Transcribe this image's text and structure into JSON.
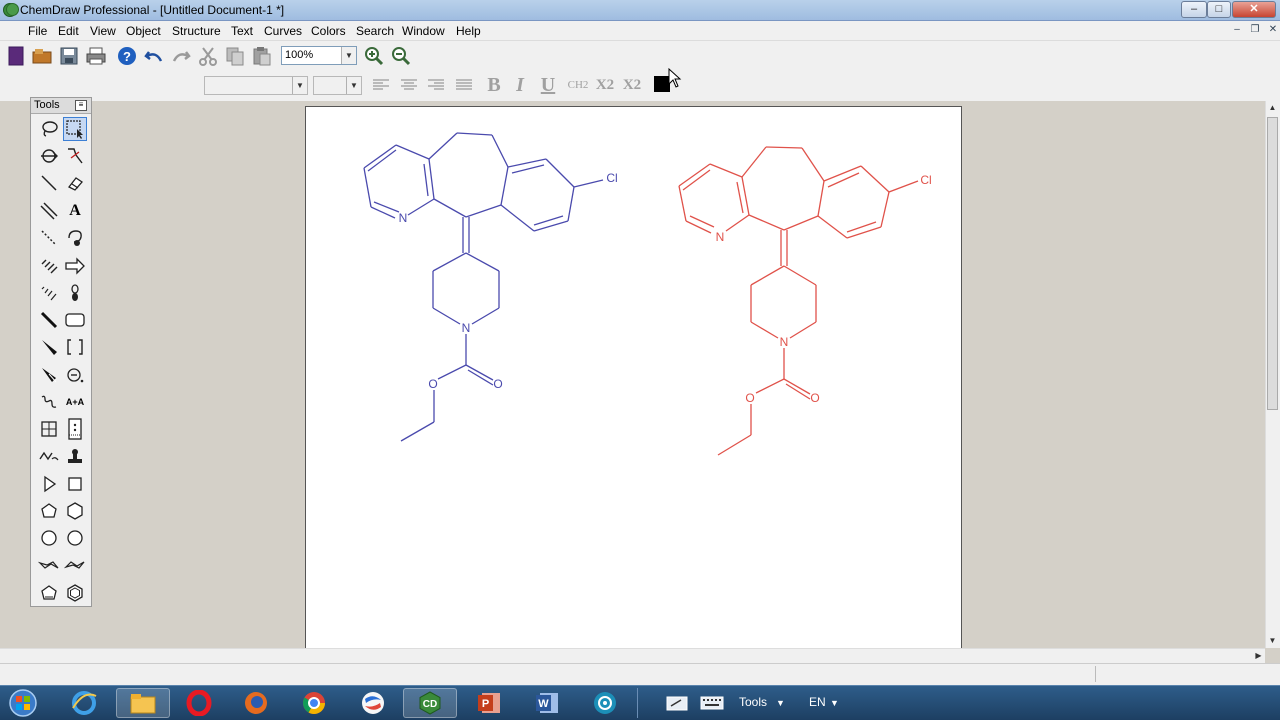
{
  "window": {
    "title": "ChemDraw Professional - [Untitled Document-1 *]",
    "controls": [
      "–",
      "□",
      "✕"
    ]
  },
  "menubar": {
    "items": [
      "File",
      "Edit",
      "View",
      "Object",
      "Structure",
      "Text",
      "Curves",
      "Colors",
      "Search",
      "Window",
      "Help"
    ]
  },
  "toolbar": {
    "zoom": "100%",
    "format_labels": {
      "bold": "B",
      "italic": "I",
      "underline": "U",
      "chemical": "CH2",
      "subscript": "X2",
      "superscript": "X2"
    },
    "text_color": "#000000"
  },
  "tools_palette": {
    "title": "Tools",
    "labels": {
      "text_tool": "A",
      "reaction_tool": "A+A"
    }
  },
  "molecules": [
    {
      "color": "#4a4aad",
      "atoms": {
        "pyridine_n": "N",
        "chlorine": "Cl",
        "piperidine_n": "N",
        "ester_o": "O",
        "carbonyl_o": "O"
      }
    },
    {
      "color": "#e0524a",
      "atoms": {
        "pyridine_n": "N",
        "chlorine": "Cl",
        "piperidine_n": "N",
        "ester_o": "O",
        "carbonyl_o": "O"
      }
    }
  ],
  "taskbar": {
    "apps": [
      "start",
      "internet-explorer",
      "file-explorer",
      "opera",
      "firefox",
      "chrome",
      "swift",
      "chemdraw",
      "powerpoint",
      "word",
      "media"
    ],
    "tray": {
      "tools_label": "Tools",
      "language": "EN"
    }
  }
}
